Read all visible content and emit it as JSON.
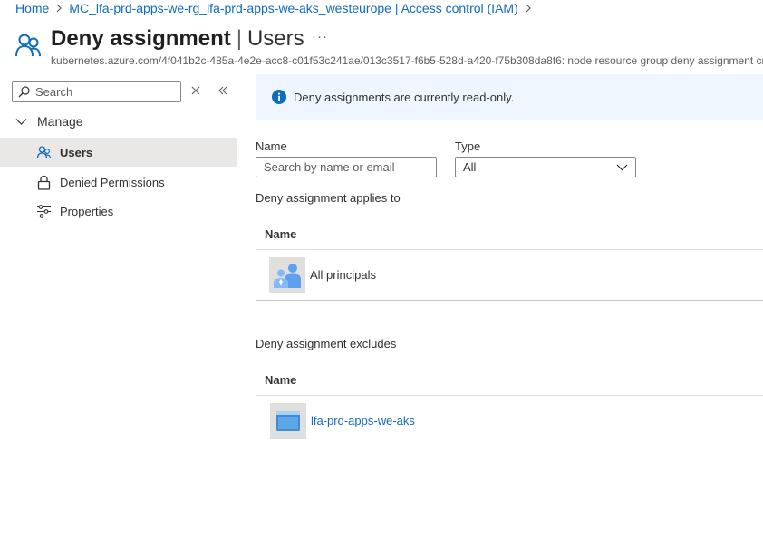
{
  "breadcrumb": {
    "items": [
      "Home",
      "MC_lfa-prd-apps-we-rg_lfa-prd-apps-we-aks_westeurope | Access control (IAM)"
    ]
  },
  "header": {
    "title": "Deny assignment",
    "separator": "|",
    "section": "Users",
    "more": "···",
    "subtitle": "kubernetes.azure.com/4f041b2c-485a-4e2e-acc8-c01f53c241ae/013c3517-f6b5-528d-a420-f75b308da8f6: node resource group deny assignment created by Azure Kubernetes Service"
  },
  "sidebar": {
    "search_placeholder": "Search",
    "group": "Manage",
    "items": [
      {
        "label": "Users",
        "icon": "users-icon",
        "active": true
      },
      {
        "label": "Denied Permissions",
        "icon": "lock-icon",
        "active": false
      },
      {
        "label": "Properties",
        "icon": "properties-icon",
        "active": false
      }
    ]
  },
  "info": {
    "text": "Deny assignments are currently read-only."
  },
  "filters": {
    "name_label": "Name",
    "name_placeholder": "Search by name or email",
    "type_label": "Type",
    "type_value": "All"
  },
  "applies": {
    "title": "Deny assignment applies to",
    "column": "Name",
    "rows": [
      {
        "name": "All principals",
        "icon": "all-principals-icon"
      }
    ]
  },
  "excludes": {
    "title": "Deny assignment excludes",
    "column": "Name",
    "rows": [
      {
        "name": "lfa-prd-apps-we-aks",
        "icon": "managed-identity-icon"
      }
    ]
  },
  "colors": {
    "link": "#0f6cbd",
    "info_bg": "#f0f6ff",
    "active_nav_bg": "#e9e8e7"
  }
}
